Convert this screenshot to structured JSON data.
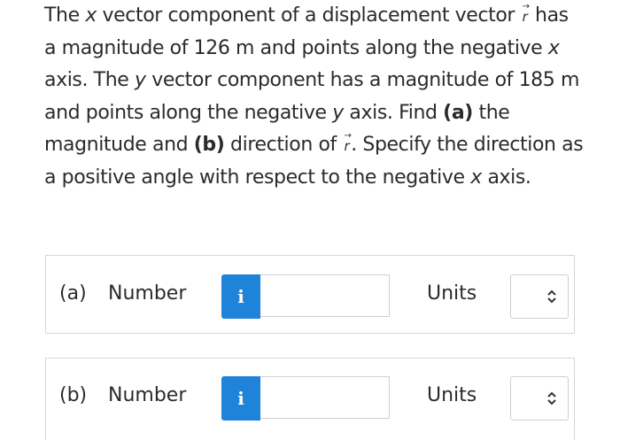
{
  "question": {
    "t1": "The ",
    "x1": "x",
    "t2": " vector component of a displacement vector ",
    "vec_symbol": "r",
    "t3": " has a magnitude of 126 m and points along the negative ",
    "x2": "x",
    "t4": " axis. The ",
    "y1": "y",
    "t5": " vector component has a magnitude of 185 m and points along the negative ",
    "y2": "y",
    "t6": " axis. Find ",
    "part_a": "(a)",
    "t7": " the magnitude and ",
    "part_b": "(b)",
    "t8": " direction of ",
    "t9": ". Specify the direction as a positive angle with respect to the negative ",
    "x3": "x",
    "t10": " axis."
  },
  "answers": [
    {
      "label": "(a)",
      "number_label": "Number",
      "info_icon": "i",
      "value": "",
      "units_label": "Units",
      "units_value": ""
    },
    {
      "label": "(b)",
      "number_label": "Number",
      "info_icon": "i",
      "value": "",
      "units_label": "Units",
      "units_value": ""
    }
  ],
  "icons": {
    "info": "info-icon",
    "select": "updown-chevron-icon"
  },
  "colors": {
    "info_button": "#1f83d9",
    "border": "#d6d6d6",
    "text": "#2b2b2b"
  }
}
